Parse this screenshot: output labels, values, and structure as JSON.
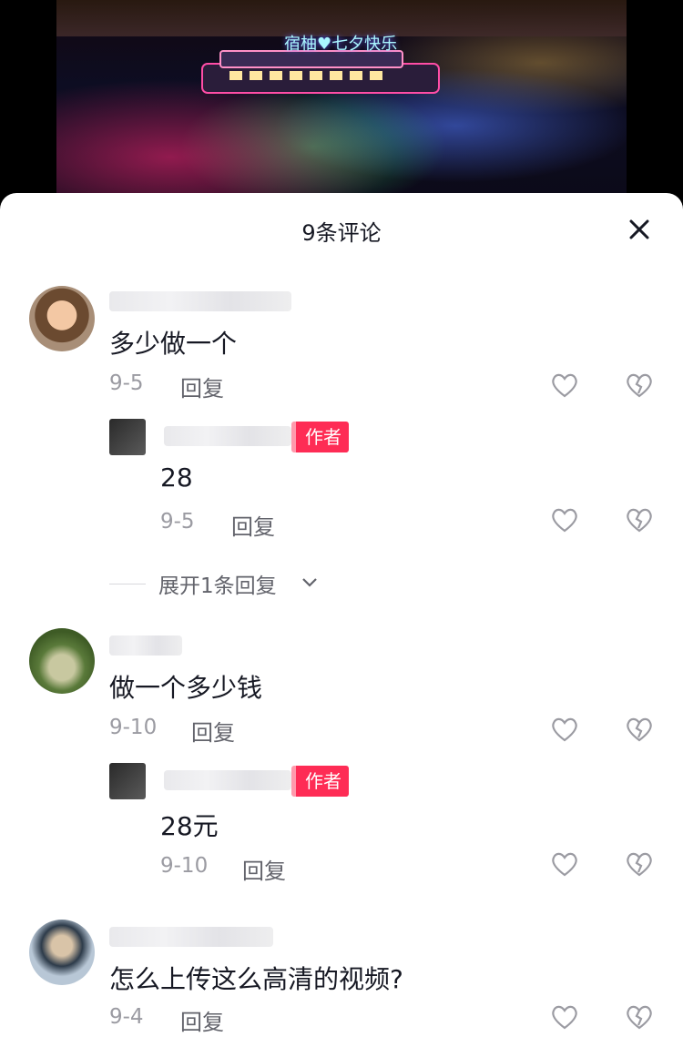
{
  "video": {
    "overlay_text": "宿柚♥七夕快乐"
  },
  "sheet": {
    "title": "9条评论"
  },
  "comments": [
    {
      "text": "多少做一个",
      "date": "9-5",
      "reply_label": "回复",
      "author_reply": {
        "badge": "作者",
        "text": "28",
        "date": "9-5",
        "reply_label": "回复"
      },
      "expand_label": "展开1条回复"
    },
    {
      "text": "做一个多少钱",
      "date": "9-10",
      "reply_label": "回复",
      "author_reply": {
        "badge": "作者",
        "text": "28元",
        "date": "9-10",
        "reply_label": "回复"
      }
    },
    {
      "text": "怎么上传这么高清的视频?",
      "date": "9-4",
      "reply_label": "回复"
    }
  ],
  "colors": {
    "accent": "#fe2c55",
    "text": "#161823",
    "muted": "#9b9ba2"
  },
  "icons": {
    "close": "close-icon",
    "like": "heart-outline-icon",
    "dislike": "broken-heart-icon",
    "expand": "chevron-down-icon"
  }
}
